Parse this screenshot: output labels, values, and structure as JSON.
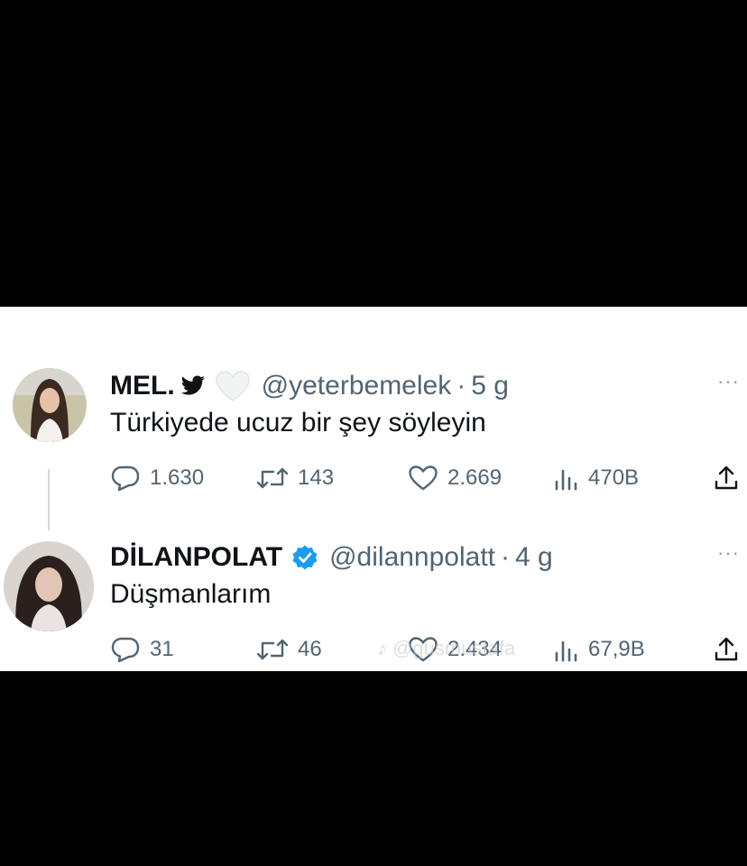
{
  "tweets": [
    {
      "name": "MEL.",
      "handle": "@yeterbemelek",
      "separator": "·",
      "age": "5 g",
      "text": "Türkiyede ucuz bir şey söyleyin",
      "replies": "1.630",
      "retweets": "143",
      "likes": "2.669",
      "views": "470B",
      "more": "···"
    },
    {
      "name": "DİLANPOLAT",
      "handle": "@dilannpolatt",
      "separator": "·",
      "age": "4 g",
      "text": "Düşmanlarım",
      "replies": "31",
      "retweets": "46",
      "likes": "2.434",
      "views": "67,9B",
      "more": "···"
    }
  ],
  "watermark": "♪ @gusmustafa",
  "colors": {
    "verified": "#1d9bf0",
    "secondary_text": "#536471",
    "primary_text": "#0f1419",
    "background": "#000000",
    "card": "#ffffff"
  }
}
